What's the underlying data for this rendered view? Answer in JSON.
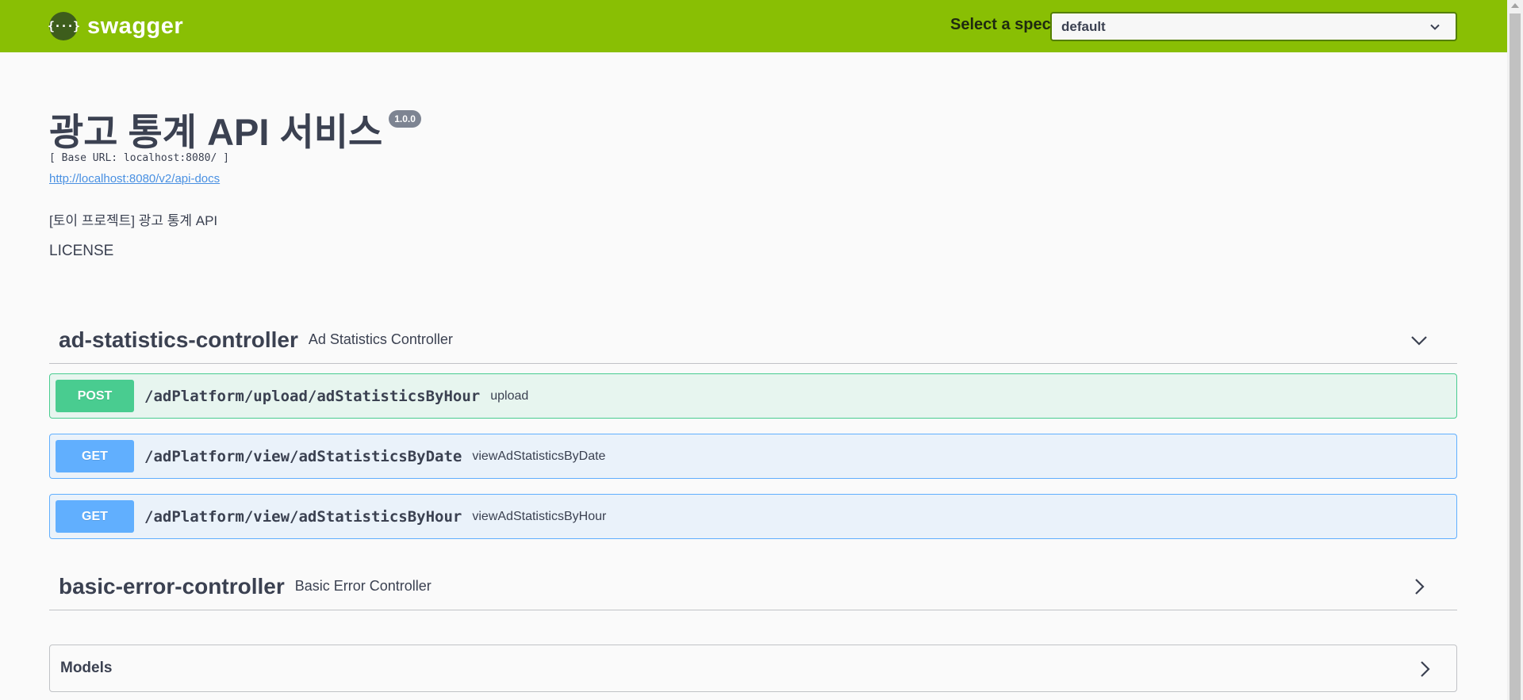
{
  "topbar": {
    "logo_glyph": "{···}",
    "brand": "swagger",
    "spec_label": "Select a spec",
    "spec_value": "default"
  },
  "info": {
    "title": "광고 통계 API 서비스",
    "version": "1.0.0",
    "base_url": "[ Base URL: localhost:8080/ ]",
    "docs_link": "http://localhost:8080/v2/api-docs",
    "description": "[토이 프로젝트] 광고 통계 API",
    "license": "LICENSE"
  },
  "tags": [
    {
      "name": "ad-statistics-controller",
      "description": "Ad Statistics Controller",
      "expanded": true,
      "operations": [
        {
          "method": "POST",
          "path": "/adPlatform/upload/adStatisticsByHour",
          "summary": "upload"
        },
        {
          "method": "GET",
          "path": "/adPlatform/view/adStatisticsByDate",
          "summary": "viewAdStatisticsByDate"
        },
        {
          "method": "GET",
          "path": "/adPlatform/view/adStatisticsByHour",
          "summary": "viewAdStatisticsByHour"
        }
      ]
    },
    {
      "name": "basic-error-controller",
      "description": "Basic Error Controller",
      "expanded": false
    }
  ],
  "models": {
    "title": "Models"
  },
  "colors": {
    "topbar": "#89bf04",
    "post": "#49cc90",
    "get": "#61affe",
    "version_badge": "#7d8492",
    "link": "#4990e2"
  }
}
